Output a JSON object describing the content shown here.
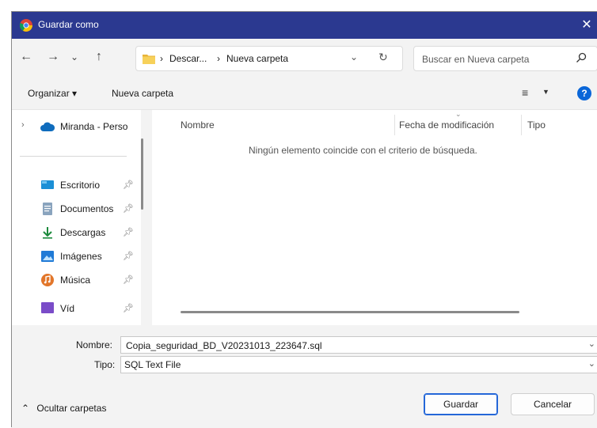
{
  "window": {
    "title": "Guardar como",
    "close_glyph": "✕"
  },
  "nav": {
    "back_icon": "arrow-left-icon",
    "forward_icon": "arrow-right-icon",
    "recent_icon": "chevron-down-icon",
    "up_icon": "arrow-up-icon",
    "breadcrumb": [
      "Descar...",
      "Nueva carpeta"
    ],
    "breadcrumb_separator": "›",
    "search_placeholder": "Buscar en Nueva carpeta"
  },
  "toolbar": {
    "organize_label": "Organizar ▾",
    "new_folder_label": "Nueva carpeta"
  },
  "sidebar": {
    "top_item": "Miranda - Perso",
    "items": [
      {
        "label": "Escritorio",
        "icon": "desktop-icon"
      },
      {
        "label": "Documentos",
        "icon": "documents-icon"
      },
      {
        "label": "Descargas",
        "icon": "downloads-icon"
      },
      {
        "label": "Imágenes",
        "icon": "pictures-icon"
      },
      {
        "label": "Música",
        "icon": "music-icon"
      },
      {
        "label": "Víd",
        "icon": "videos-icon"
      }
    ]
  },
  "file_list": {
    "columns": [
      "Nombre",
      "Fecha de modificación",
      "Tipo"
    ],
    "empty_message": "Ningún elemento coincide con el criterio de búsqueda."
  },
  "form": {
    "name_label": "Nombre:",
    "name_value": "Copia_seguridad_BD_V20231013_223647.sql",
    "type_label": "Tipo:",
    "type_value": "SQL Text File"
  },
  "footer": {
    "hide_folders_label": "Ocultar carpetas",
    "save_label": "Guardar",
    "cancel_label": "Cancelar"
  },
  "colors": {
    "titlebar": "#2b3990",
    "accent": "#2467d8",
    "help": "#0a66d8"
  }
}
